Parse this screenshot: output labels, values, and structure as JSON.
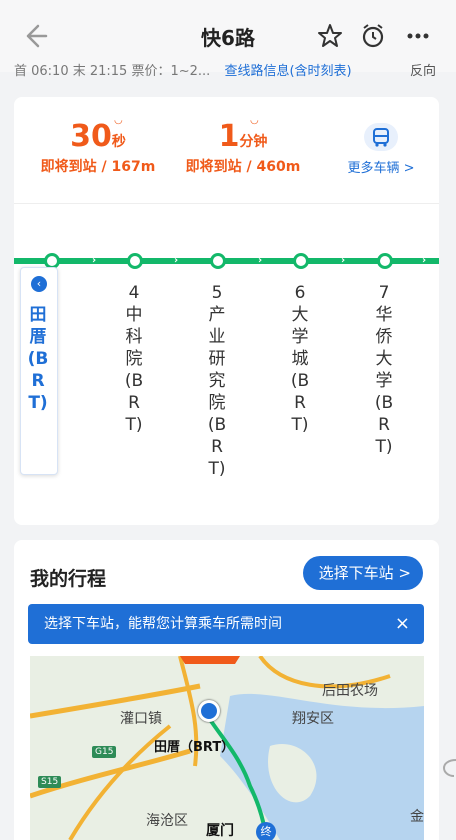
{
  "header": {
    "title": "快6路",
    "subinfo": "首 06:10 末 21:15 票价：1~2...",
    "route_link": "查线路信息(含时刻表)",
    "right_text": "反向"
  },
  "arrivals": [
    {
      "value": "30",
      "unit": "秒",
      "status": "即将到站 / 167m"
    },
    {
      "value": "1",
      "unit": "分钟",
      "status": "即将到站 / 460m"
    }
  ],
  "more_buses": "更多车辆 >",
  "stops": [
    {
      "index": "",
      "name": "田厝(BRT)",
      "current": true
    },
    {
      "index": "4",
      "name": "中科院(BRT)",
      "current": false
    },
    {
      "index": "5",
      "name": "产业研究院(BRT)",
      "current": false
    },
    {
      "index": "6",
      "name": "大学城(BRT)",
      "current": false
    },
    {
      "index": "7",
      "name": "华侨大学(BRT)",
      "current": false
    }
  ],
  "trip": {
    "title": "我的行程",
    "select_button": "选择下车站 >",
    "tip": "选择下车站，能帮您计算乘车所需时间",
    "tip_close": "×"
  },
  "map": {
    "labels": [
      "后田农场",
      "灌口镇",
      "翔安区",
      "田厝（BRT）",
      "海沧区",
      "厦门",
      "金"
    ],
    "roads": [
      "G15",
      "S15"
    ],
    "end_marker": "终"
  },
  "colors": {
    "accent": "#1f6fd6",
    "orange": "#f05a1a",
    "line": "#13b86a"
  }
}
